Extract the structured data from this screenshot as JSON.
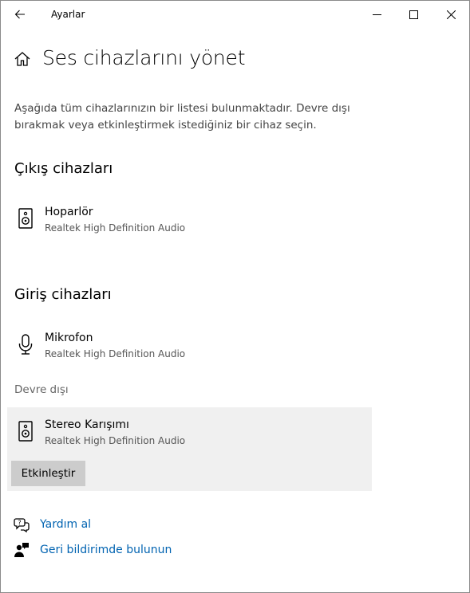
{
  "window": {
    "title": "Ayarlar",
    "back_icon": "arrow-left-icon",
    "controls": [
      "minimize-icon",
      "maximize-icon",
      "close-icon"
    ]
  },
  "header": {
    "icon": "home-icon",
    "title": "Ses cihazlarını yönet"
  },
  "description": "Aşağıda tüm cihazlarınızın bir listesi bulunmaktadır. Devre dışı bırakmak veya etkinleştirmek istediğiniz bir cihaz seçin.",
  "output": {
    "section_title": "Çıkış cihazları",
    "devices": [
      {
        "icon": "speaker-icon",
        "name": "Hoparlör",
        "driver": "Realtek High Definition Audio"
      }
    ]
  },
  "input": {
    "section_title": "Giriş cihazları",
    "devices": [
      {
        "icon": "microphone-icon",
        "name": "Mikrofon",
        "driver": "Realtek High Definition Audio"
      }
    ],
    "disabled_label": "Devre dışı",
    "disabled_devices": [
      {
        "icon": "speaker-icon",
        "name": "Stereo Karışımı",
        "driver": "Realtek High Definition Audio",
        "button_label": "Etkinleştir"
      }
    ]
  },
  "links": [
    {
      "icon": "help-chat-icon",
      "label": "Yardım al"
    },
    {
      "icon": "feedback-icon",
      "label": "Geri bildirimde bulunun"
    }
  ],
  "colors": {
    "link": "#0063b1",
    "disabled_panel_bg": "#f0f0f0",
    "button_bg": "#cccccc"
  }
}
